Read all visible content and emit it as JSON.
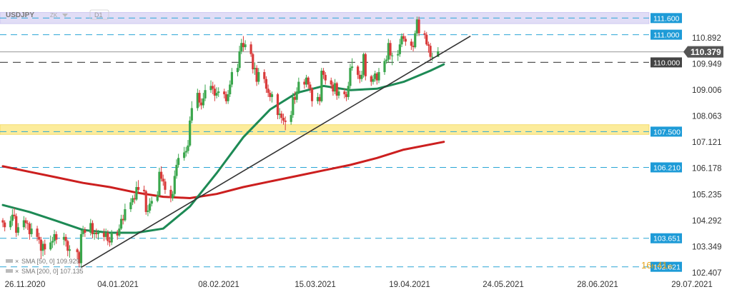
{
  "header": {
    "symbol": "USDJPY",
    "currency_hint": "ZK",
    "timeframe": "D1"
  },
  "legend": {
    "sma50": "SMA [50, 0] 109.929",
    "sma200": "SMA [200, 0] 107.135"
  },
  "timer": {
    "hours": "16",
    "h": "h",
    "minutes": "41",
    "m": "m"
  },
  "colors": {
    "up": "#3aa64c",
    "down": "#d93a3a",
    "sma50": "#1d8a55",
    "sma200": "#cc1f1f",
    "trend": "#333333",
    "level": "#2aa6d6",
    "resistance_zone": "#dcd8f5",
    "support_zone": "#fce98a"
  },
  "chart_data": {
    "type": "candlestick",
    "symbol": "USDJPY",
    "timeframe": "D1",
    "current_price": 110.379,
    "y_ticks": [
      110.892,
      109.949,
      109.006,
      108.063,
      107.121,
      106.178,
      105.235,
      104.292,
      103.349,
      102.407
    ],
    "x_ticks": [
      "26.11.2020",
      "04.01.2021",
      "08.02.2021",
      "15.03.2021",
      "19.04.2021",
      "24.05.2021",
      "28.06.2021",
      "29.07.2021"
    ],
    "levels": [
      {
        "value": 111.6,
        "label": "111.600"
      },
      {
        "value": 111.0,
        "label": "111.000"
      },
      {
        "value": 110.0,
        "label": "110.000"
      },
      {
        "value": 107.5,
        "label": "107.500"
      },
      {
        "value": 106.21,
        "label": "106.210"
      },
      {
        "value": 103.651,
        "label": "103.651"
      },
      {
        "value": 102.621,
        "label": "102.621"
      }
    ],
    "zones": [
      {
        "name": "resistance",
        "from": 111.4,
        "to": 111.8
      },
      {
        "name": "support",
        "from": 107.4,
        "to": 107.75
      }
    ],
    "sma50": [
      [
        "2020-11-26",
        104.85
      ],
      [
        "2020-12-10",
        104.6
      ],
      [
        "2020-12-24",
        104.28
      ],
      [
        "2021-01-07",
        103.95
      ],
      [
        "2021-01-21",
        103.85
      ],
      [
        "2021-02-04",
        103.85
      ],
      [
        "2021-02-18",
        104.0
      ],
      [
        "2021-03-04",
        104.8
      ],
      [
        "2021-03-18",
        106.0
      ],
      [
        "2021-04-01",
        107.3
      ],
      [
        "2021-04-15",
        108.3
      ],
      [
        "2021-04-29",
        108.9
      ],
      [
        "2021-05-13",
        109.15
      ],
      [
        "2021-05-27",
        109.0
      ],
      [
        "2021-06-10",
        109.05
      ],
      [
        "2021-06-24",
        109.3
      ],
      [
        "2021-07-08",
        109.7
      ],
      [
        "2021-07-15",
        109.93
      ]
    ],
    "sma200": [
      [
        "2020-11-26",
        106.25
      ],
      [
        "2020-12-10",
        106.05
      ],
      [
        "2020-12-24",
        105.85
      ],
      [
        "2021-01-07",
        105.65
      ],
      [
        "2021-01-21",
        105.5
      ],
      [
        "2021-02-04",
        105.3
      ],
      [
        "2021-02-18",
        105.15
      ],
      [
        "2021-03-04",
        105.1
      ],
      [
        "2021-03-18",
        105.25
      ],
      [
        "2021-04-01",
        105.5
      ],
      [
        "2021-04-15",
        105.7
      ],
      [
        "2021-04-29",
        105.9
      ],
      [
        "2021-05-13",
        106.1
      ],
      [
        "2021-05-27",
        106.3
      ],
      [
        "2021-06-10",
        106.55
      ],
      [
        "2021-06-24",
        106.85
      ],
      [
        "2021-07-15",
        107.13
      ]
    ],
    "trendline": [
      [
        "2021-01-06",
        102.6
      ],
      [
        "2021-07-29",
        110.95
      ]
    ],
    "candles": [
      [
        "2020-11-26",
        104.3,
        104.22,
        104.38,
        104.05
      ],
      [
        "2020-11-27",
        104.22,
        104.05,
        104.3,
        103.9
      ],
      [
        "2020-11-30",
        104.05,
        104.28,
        104.45,
        103.95
      ],
      [
        "2020-12-01",
        104.28,
        104.5,
        104.7,
        104.1
      ],
      [
        "2020-12-02",
        104.5,
        104.45,
        104.75,
        104.35
      ],
      [
        "2020-12-03",
        104.45,
        103.85,
        104.55,
        103.7
      ],
      [
        "2020-12-04",
        103.85,
        104.05,
        104.2,
        103.75
      ],
      [
        "2020-12-07",
        104.05,
        104.3,
        104.45,
        103.95
      ],
      [
        "2020-12-08",
        104.3,
        104.2,
        104.4,
        104.0
      ],
      [
        "2020-12-09",
        104.2,
        104.18,
        104.3,
        103.95
      ],
      [
        "2020-12-10",
        104.18,
        103.8,
        104.25,
        103.6
      ],
      [
        "2020-12-11",
        103.8,
        104.0,
        104.2,
        103.7
      ],
      [
        "2020-12-14",
        104.0,
        103.7,
        104.1,
        103.55
      ],
      [
        "2020-12-15",
        103.7,
        103.6,
        103.85,
        103.45
      ],
      [
        "2020-12-16",
        103.6,
        103.2,
        103.7,
        102.9
      ],
      [
        "2020-12-17",
        103.2,
        103.45,
        103.55,
        103.0
      ],
      [
        "2020-12-18",
        103.45,
        103.25,
        103.6,
        103.05
      ],
      [
        "2020-12-21",
        103.25,
        103.5,
        103.75,
        103.2
      ],
      [
        "2020-12-22",
        103.5,
        103.55,
        103.7,
        103.3
      ],
      [
        "2020-12-23",
        103.55,
        103.8,
        103.95,
        103.4
      ],
      [
        "2020-12-24",
        103.8,
        103.6,
        103.9,
        103.45
      ],
      [
        "2020-12-28",
        103.6,
        103.7,
        103.85,
        103.4
      ],
      [
        "2020-12-29",
        103.7,
        103.55,
        103.8,
        103.35
      ],
      [
        "2020-12-30",
        103.55,
        103.2,
        103.6,
        103.0
      ],
      [
        "2020-12-31",
        103.2,
        103.25,
        103.4,
        102.95
      ],
      [
        "2021-01-04",
        103.25,
        103.15,
        103.3,
        102.9
      ],
      [
        "2021-01-05",
        103.15,
        102.75,
        103.2,
        102.6
      ],
      [
        "2021-01-06",
        102.75,
        103.8,
        103.95,
        102.6
      ],
      [
        "2021-01-07",
        103.8,
        103.95,
        104.1,
        103.7
      ],
      [
        "2021-01-08",
        103.95,
        103.85,
        104.05,
        103.7
      ],
      [
        "2021-01-11",
        103.85,
        104.2,
        104.35,
        103.75
      ],
      [
        "2021-01-12",
        104.2,
        103.8,
        104.3,
        103.65
      ],
      [
        "2021-01-13",
        103.8,
        103.85,
        103.95,
        103.6
      ],
      [
        "2021-01-14",
        103.85,
        103.8,
        104.0,
        103.65
      ],
      [
        "2021-01-15",
        103.8,
        103.85,
        103.95,
        103.6
      ],
      [
        "2021-01-18",
        103.85,
        103.7,
        104.0,
        103.55
      ],
      [
        "2021-01-19",
        103.7,
        103.85,
        104.0,
        103.6
      ],
      [
        "2021-01-20",
        103.85,
        103.55,
        103.95,
        103.4
      ],
      [
        "2021-01-21",
        103.55,
        103.5,
        103.7,
        103.35
      ],
      [
        "2021-01-22",
        103.5,
        103.85,
        103.95,
        103.4
      ],
      [
        "2021-01-25",
        103.85,
        103.75,
        103.95,
        103.6
      ],
      [
        "2021-01-26",
        103.75,
        104.0,
        104.15,
        103.7
      ],
      [
        "2021-01-27",
        104.0,
        104.35,
        104.5,
        103.95
      ],
      [
        "2021-01-28",
        104.35,
        104.3,
        104.5,
        104.15
      ],
      [
        "2021-01-29",
        104.3,
        104.7,
        104.9,
        104.25
      ],
      [
        "2021-02-01",
        104.7,
        104.95,
        105.1,
        104.6
      ],
      [
        "2021-02-02",
        104.95,
        105.1,
        105.2,
        104.85
      ],
      [
        "2021-02-03",
        105.1,
        105.05,
        105.25,
        104.9
      ],
      [
        "2021-02-04",
        105.05,
        105.5,
        105.7,
        105.0
      ],
      [
        "2021-02-05",
        105.5,
        105.4,
        105.75,
        105.3
      ],
      [
        "2021-02-08",
        105.4,
        105.35,
        105.55,
        105.2
      ],
      [
        "2021-02-09",
        105.35,
        104.6,
        105.4,
        104.5
      ],
      [
        "2021-02-10",
        104.6,
        104.65,
        104.85,
        104.45
      ],
      [
        "2021-02-11",
        104.65,
        104.9,
        105.1,
        104.55
      ],
      [
        "2021-02-12",
        104.9,
        105.0,
        105.15,
        104.8
      ],
      [
        "2021-02-15",
        105.0,
        105.2,
        105.35,
        104.95
      ],
      [
        "2021-02-16",
        105.2,
        106.05,
        106.2,
        105.15
      ],
      [
        "2021-02-17",
        106.05,
        105.8,
        106.25,
        105.7
      ],
      [
        "2021-02-18",
        105.8,
        105.7,
        105.95,
        105.55
      ],
      [
        "2021-02-19",
        105.7,
        105.4,
        105.8,
        105.25
      ],
      [
        "2021-02-22",
        105.4,
        105.1,
        105.55,
        104.95
      ],
      [
        "2021-02-23",
        105.1,
        105.25,
        105.35,
        105.0
      ],
      [
        "2021-02-24",
        105.25,
        105.9,
        106.1,
        105.15
      ],
      [
        "2021-02-25",
        105.9,
        106.3,
        106.5,
        105.8
      ],
      [
        "2021-02-26",
        106.3,
        106.55,
        106.7,
        106.2
      ],
      [
        "2021-03-01",
        106.55,
        106.75,
        106.95,
        106.45
      ],
      [
        "2021-03-02",
        106.75,
        106.8,
        106.95,
        106.6
      ],
      [
        "2021-03-03",
        106.8,
        107.0,
        107.2,
        106.7
      ],
      [
        "2021-03-04",
        107.0,
        107.9,
        108.05,
        106.95
      ],
      [
        "2021-03-05",
        107.9,
        108.35,
        108.6,
        107.8
      ],
      [
        "2021-03-08",
        108.35,
        108.9,
        109.05,
        108.25
      ],
      [
        "2021-03-09",
        108.9,
        108.55,
        109.0,
        108.4
      ],
      [
        "2021-03-10",
        108.55,
        108.45,
        108.7,
        108.3
      ],
      [
        "2021-03-11",
        108.45,
        108.7,
        108.9,
        108.35
      ],
      [
        "2021-03-12",
        108.7,
        109.0,
        109.2,
        108.6
      ],
      [
        "2021-03-15",
        109.0,
        109.15,
        109.35,
        108.9
      ],
      [
        "2021-03-16",
        109.15,
        109.05,
        109.3,
        108.85
      ],
      [
        "2021-03-17",
        109.05,
        108.8,
        109.2,
        108.6
      ],
      [
        "2021-03-18",
        108.8,
        108.9,
        109.1,
        108.7
      ],
      [
        "2021-03-19",
        108.9,
        108.95,
        109.1,
        108.75
      ],
      [
        "2021-03-22",
        108.95,
        108.85,
        109.05,
        108.7
      ],
      [
        "2021-03-23",
        108.85,
        108.6,
        108.95,
        108.5
      ],
      [
        "2021-03-24",
        108.6,
        108.85,
        109.0,
        108.5
      ],
      [
        "2021-03-25",
        108.85,
        109.2,
        109.35,
        108.75
      ],
      [
        "2021-03-26",
        109.2,
        109.65,
        109.8,
        109.1
      ],
      [
        "2021-03-29",
        109.65,
        109.8,
        109.95,
        109.5
      ],
      [
        "2021-03-30",
        109.8,
        110.4,
        110.6,
        109.7
      ],
      [
        "2021-03-31",
        110.4,
        110.7,
        110.85,
        110.3
      ],
      [
        "2021-04-01",
        110.7,
        110.55,
        110.95,
        110.4
      ],
      [
        "2021-04-02",
        110.55,
        110.65,
        110.8,
        110.45
      ],
      [
        "2021-04-05",
        110.65,
        110.3,
        110.75,
        110.2
      ],
      [
        "2021-04-06",
        110.3,
        109.75,
        110.35,
        109.6
      ],
      [
        "2021-04-07",
        109.75,
        109.8,
        110.0,
        109.55
      ],
      [
        "2021-04-08",
        109.8,
        109.3,
        109.9,
        109.15
      ],
      [
        "2021-04-09",
        109.3,
        109.65,
        109.8,
        109.2
      ],
      [
        "2021-04-12",
        109.65,
        109.4,
        109.75,
        109.25
      ],
      [
        "2021-04-13",
        109.4,
        109.05,
        109.5,
        108.9
      ],
      [
        "2021-04-14",
        109.05,
        108.9,
        109.2,
        108.75
      ],
      [
        "2021-04-15",
        108.9,
        108.75,
        109.0,
        108.6
      ],
      [
        "2021-04-16",
        108.75,
        108.85,
        108.95,
        108.55
      ],
      [
        "2021-04-19",
        108.85,
        108.1,
        108.9,
        107.95
      ],
      [
        "2021-04-20",
        108.1,
        108.15,
        108.35,
        107.95
      ],
      [
        "2021-04-21",
        108.15,
        108.0,
        108.25,
        107.8
      ],
      [
        "2021-04-22",
        108.0,
        107.9,
        108.15,
        107.75
      ],
      [
        "2021-04-23",
        107.9,
        107.85,
        108.05,
        107.55
      ],
      [
        "2021-04-26",
        107.85,
        108.1,
        108.25,
        107.75
      ],
      [
        "2021-04-27",
        108.1,
        108.75,
        108.9,
        108.0
      ],
      [
        "2021-04-28",
        108.75,
        108.65,
        108.95,
        108.5
      ],
      [
        "2021-04-29",
        108.65,
        108.95,
        109.1,
        108.55
      ],
      [
        "2021-04-30",
        108.95,
        109.3,
        109.45,
        108.85
      ],
      [
        "2021-05-03",
        109.3,
        109.2,
        109.4,
        109.05
      ],
      [
        "2021-05-04",
        109.2,
        109.45,
        109.55,
        109.1
      ],
      [
        "2021-05-05",
        109.45,
        109.2,
        109.5,
        109.05
      ],
      [
        "2021-05-06",
        109.2,
        109.05,
        109.3,
        108.9
      ],
      [
        "2021-05-07",
        109.05,
        108.6,
        109.1,
        108.4
      ],
      [
        "2021-05-10",
        108.6,
        108.75,
        108.9,
        108.5
      ],
      [
        "2021-05-11",
        108.75,
        108.6,
        108.85,
        108.45
      ],
      [
        "2021-05-12",
        108.6,
        109.7,
        109.8,
        108.55
      ],
      [
        "2021-05-13",
        109.7,
        109.55,
        109.8,
        109.4
      ],
      [
        "2021-05-14",
        109.55,
        109.35,
        109.65,
        109.2
      ],
      [
        "2021-05-17",
        109.35,
        109.2,
        109.45,
        109.05
      ],
      [
        "2021-05-18",
        109.2,
        108.95,
        109.3,
        108.8
      ],
      [
        "2021-05-19",
        108.95,
        109.25,
        109.4,
        108.85
      ],
      [
        "2021-05-20",
        109.25,
        108.8,
        109.3,
        108.65
      ],
      [
        "2021-05-21",
        108.8,
        108.95,
        109.05,
        108.7
      ],
      [
        "2021-05-24",
        108.95,
        108.85,
        109.05,
        108.7
      ],
      [
        "2021-05-25",
        108.85,
        108.75,
        108.95,
        108.6
      ],
      [
        "2021-05-26",
        108.75,
        109.15,
        109.3,
        108.65
      ],
      [
        "2021-05-27",
        109.15,
        109.8,
        109.95,
        109.05
      ],
      [
        "2021-05-28",
        109.8,
        109.85,
        110.15,
        109.7
      ],
      [
        "2021-05-31",
        109.85,
        109.55,
        109.9,
        109.4
      ],
      [
        "2021-06-01",
        109.55,
        109.4,
        109.7,
        109.25
      ],
      [
        "2021-06-02",
        109.4,
        109.55,
        109.7,
        109.3
      ],
      [
        "2021-06-03",
        109.55,
        110.3,
        110.35,
        109.45
      ],
      [
        "2021-06-04",
        110.3,
        109.5,
        110.35,
        109.35
      ],
      [
        "2021-06-07",
        109.5,
        109.3,
        109.55,
        109.15
      ],
      [
        "2021-06-08",
        109.3,
        109.4,
        109.55,
        109.2
      ],
      [
        "2021-06-09",
        109.4,
        109.6,
        109.7,
        109.3
      ],
      [
        "2021-06-10",
        109.6,
        109.35,
        109.65,
        109.2
      ],
      [
        "2021-06-11",
        109.35,
        109.65,
        109.8,
        109.25
      ],
      [
        "2021-06-14",
        109.65,
        110.05,
        110.15,
        109.55
      ],
      [
        "2021-06-15",
        110.05,
        110.1,
        110.25,
        109.95
      ],
      [
        "2021-06-16",
        110.1,
        110.7,
        110.85,
        110.0
      ],
      [
        "2021-06-17",
        110.7,
        110.25,
        110.8,
        110.1
      ],
      [
        "2021-06-18",
        110.25,
        110.25,
        110.35,
        109.9
      ],
      [
        "2021-06-21",
        110.25,
        110.3,
        110.45,
        110.05
      ],
      [
        "2021-06-22",
        110.3,
        110.65,
        110.85,
        110.2
      ],
      [
        "2021-06-23",
        110.65,
        110.95,
        111.05,
        110.55
      ],
      [
        "2021-06-24",
        110.95,
        110.85,
        111.05,
        110.75
      ],
      [
        "2021-06-25",
        110.85,
        110.75,
        110.95,
        110.6
      ],
      [
        "2021-06-28",
        110.75,
        110.6,
        110.85,
        110.45
      ],
      [
        "2021-06-29",
        110.6,
        110.55,
        110.75,
        110.4
      ],
      [
        "2021-06-30",
        110.55,
        111.05,
        111.15,
        110.5
      ],
      [
        "2021-07-01",
        111.05,
        111.55,
        111.65,
        110.95
      ],
      [
        "2021-07-02",
        111.55,
        111.05,
        111.65,
        110.95
      ],
      [
        "2021-07-05",
        111.05,
        111.0,
        111.15,
        110.85
      ],
      [
        "2021-07-06",
        111.0,
        110.65,
        111.1,
        110.6
      ],
      [
        "2021-07-07",
        110.65,
        110.6,
        110.75,
        110.35
      ],
      [
        "2021-07-08",
        110.6,
        110.2,
        110.7,
        110.05
      ],
      [
        "2021-07-09",
        110.2,
        110.2,
        110.35,
        110.05
      ],
      [
        "2021-07-12",
        110.2,
        110.4,
        110.55,
        110.25
      ]
    ]
  }
}
